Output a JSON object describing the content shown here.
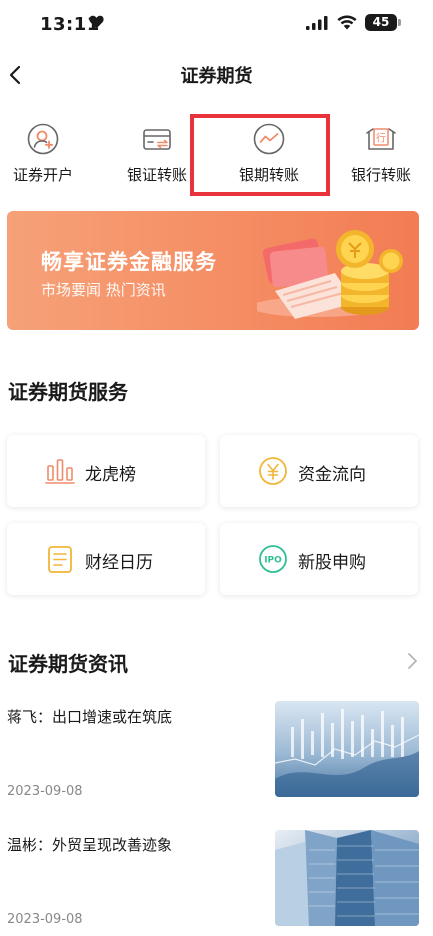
{
  "status_bar": {
    "time": "13:11",
    "battery": "45"
  },
  "nav": {
    "title": "证券期货"
  },
  "quick_actions": [
    {
      "label": "证券开户",
      "icon": "user-add-icon"
    },
    {
      "label": "银证转账",
      "icon": "card-transfer-icon"
    },
    {
      "label": "银期转账",
      "icon": "trend-circle-icon",
      "highlighted": true
    },
    {
      "label": "银行转账",
      "icon": "bank-icon"
    }
  ],
  "banner": {
    "title": "畅享证券金融服务",
    "subtitle": "市场要闻 热门资讯"
  },
  "services_section": {
    "title": "证券期货服务",
    "items": [
      {
        "label": "龙虎榜",
        "icon": "bar-chart-icon"
      },
      {
        "label": "资金流向",
        "icon": "yuan-coin-icon"
      },
      {
        "label": "财经日历",
        "icon": "calendar-icon"
      },
      {
        "label": "新股申购",
        "icon": "ipo-icon"
      }
    ]
  },
  "news_section": {
    "title": "证券期货资讯",
    "items": [
      {
        "title": "蒋飞：出口增速或在筑底",
        "date": "2023-09-08"
      },
      {
        "title": "温彬：外贸呈现改善迹象",
        "date": "2023-09-08"
      }
    ]
  },
  "colors": {
    "accent_orange": "#f58d63",
    "highlight_red": "#e8333c",
    "icon_orange": "#f08c6a",
    "icon_yellow": "#f2b63a",
    "icon_green": "#2fbf96"
  }
}
